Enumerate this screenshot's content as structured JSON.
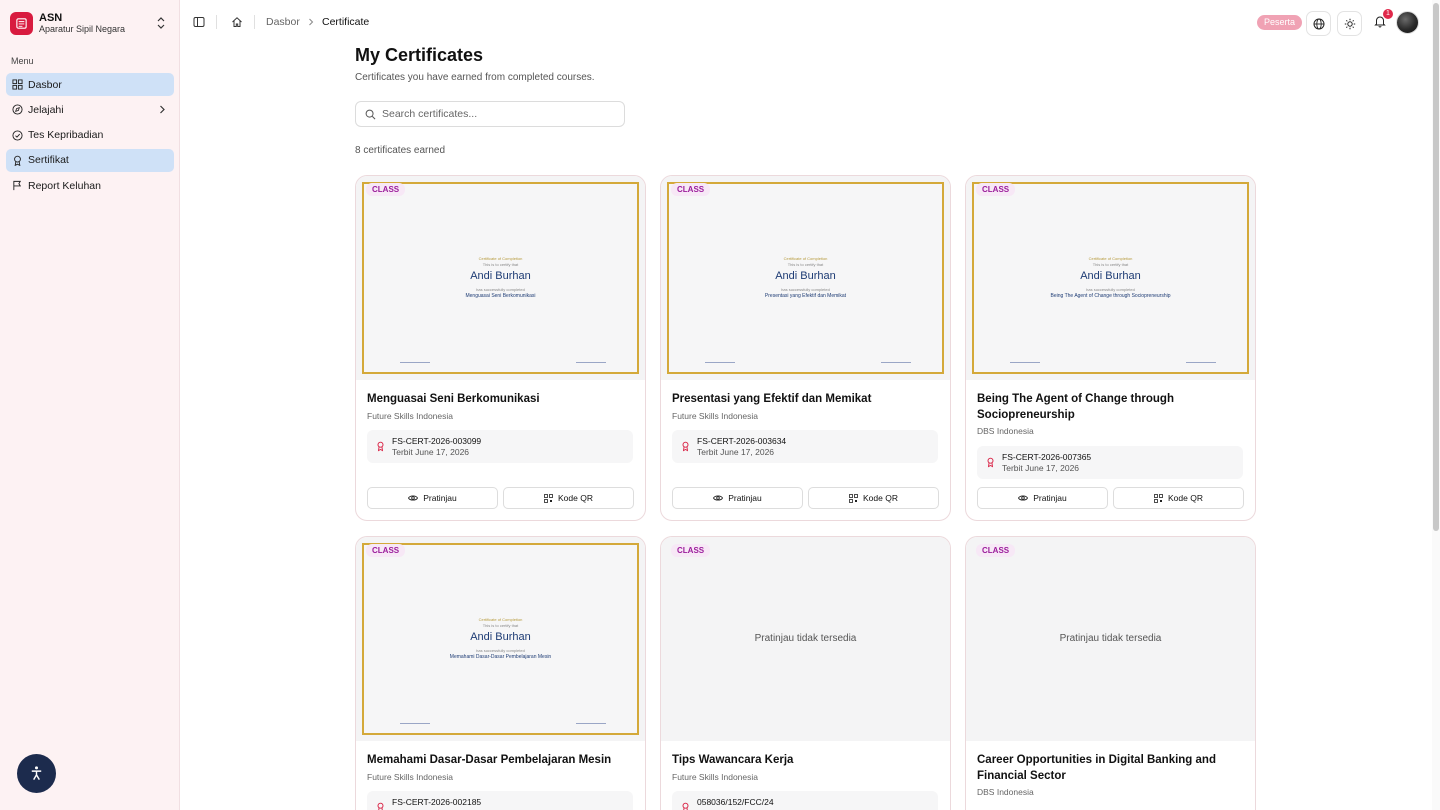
{
  "brand": {
    "title": "ASN",
    "subtitle": "Aparatur Sipil Negara"
  },
  "sidebar": {
    "menu_label": "Menu",
    "items": [
      {
        "label": "Dasbor"
      },
      {
        "label": "Jelajahi"
      },
      {
        "label": "Tes Kepribadian"
      },
      {
        "label": "Sertifikat"
      },
      {
        "label": "Report Keluhan"
      }
    ]
  },
  "topbar": {
    "breadcrumb_home": "Dasbor",
    "breadcrumb_current": "Certificate",
    "role": "Peserta",
    "notification_count": "1"
  },
  "main": {
    "title": "My Certificates",
    "subtitle": "Certificates you have earned from completed courses.",
    "search_placeholder": "Search certificates...",
    "count_text": "8 certificates earned"
  },
  "cert_preview": {
    "heading": "Certificate of Completion",
    "presented": "This is to certify that",
    "recipient": "Andi Burhan",
    "completed": "has successfully completed"
  },
  "cards": [
    {
      "badge": "CLASS",
      "title": "Menguasai Seni Berkomunikasi",
      "org": "Future Skills Indonesia",
      "cert_id": "FS-CERT-2026-003099",
      "issued": "Terbit June 17, 2026",
      "preview_course": "Menguasai Seni Berkomunikasi",
      "preview_label": "Pratinjau",
      "qr_label": "Kode QR"
    },
    {
      "badge": "CLASS",
      "title": "Presentasi yang Efektif dan Memikat",
      "org": "Future Skills Indonesia",
      "cert_id": "FS-CERT-2026-003634",
      "issued": "Terbit June 17, 2026",
      "preview_course": "Presentasi yang Efektif dan Memikat",
      "preview_label": "Pratinjau",
      "qr_label": "Kode QR"
    },
    {
      "badge": "CLASS",
      "title": "Being The Agent of Change through Sociopreneurship",
      "org": "DBS Indonesia",
      "cert_id": "FS-CERT-2026-007365",
      "issued": "Terbit June 17, 2026",
      "preview_course": "Being The Agent of Change through Sociopreneurship",
      "preview_label": "Pratinjau",
      "qr_label": "Kode QR"
    },
    {
      "badge": "CLASS",
      "title": "Memahami Dasar-Dasar Pembelajaran Mesin",
      "org": "Future Skills Indonesia",
      "cert_id": "FS-CERT-2026-002185",
      "preview_course": "Memahami Dasar-Dasar Pembelajaran Mesin"
    },
    {
      "badge": "CLASS",
      "title": "Tips Wawancara Kerja",
      "org": "Future Skills Indonesia",
      "cert_id": "058036/152/FCC/24",
      "no_preview": "Pratinjau tidak tersedia"
    },
    {
      "badge": "CLASS",
      "title": "Career Opportunities in Digital Banking and Financial Sector",
      "org": "DBS Indonesia",
      "no_preview": "Pratinjau tidak tersedia"
    }
  ],
  "colors": {
    "brand": "#d81b3f",
    "active_nav": "#cfe1f7",
    "cert_border": "#d4a93a",
    "badge_text": "#9b1c9b",
    "role_badge": "#f0a2b4"
  }
}
